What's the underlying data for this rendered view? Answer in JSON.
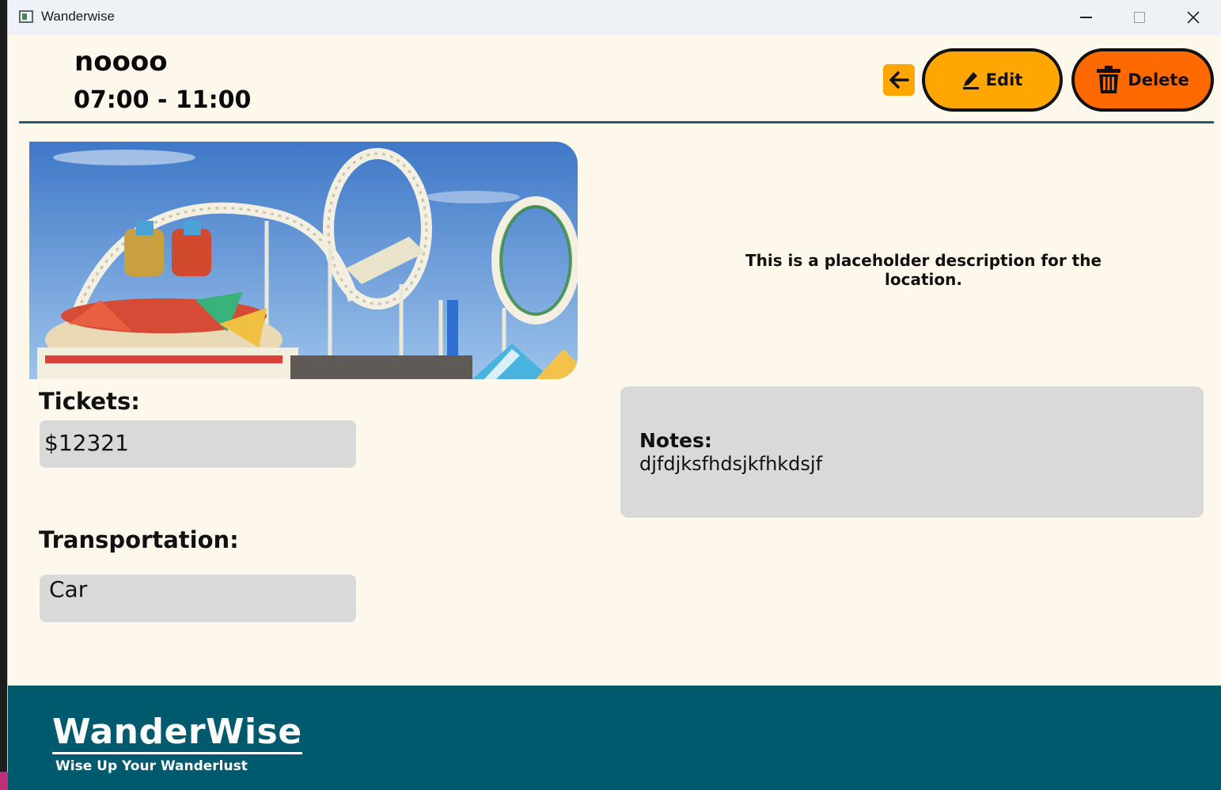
{
  "window": {
    "title": "Wanderwise"
  },
  "header": {
    "title": "noooo",
    "time": "07:00 - 11:00",
    "edit_label": "Edit",
    "delete_label": "Delete"
  },
  "main": {
    "description": "This is a placeholder description for the location.",
    "tickets_label": "Tickets:",
    "tickets_value": "$12321",
    "transportation_label": "Transportation:",
    "transportation_value": "Car",
    "notes_label": "Notes:",
    "notes_value": "djfdjksfhdsjkfhkdsjf"
  },
  "footer": {
    "brand": "WanderWise",
    "tagline": "Wise Up Your Wanderlust"
  },
  "colors": {
    "background": "#fdf7ec",
    "accent_orange": "#ffa600",
    "delete_orange": "#ff6a00",
    "teal": "#005a6e",
    "field_gray": "#d9d9d9"
  },
  "icons": [
    "app-icon",
    "arrow-left-icon",
    "pencil-icon",
    "trash-icon",
    "minimize-icon",
    "maximize-icon",
    "close-icon"
  ]
}
